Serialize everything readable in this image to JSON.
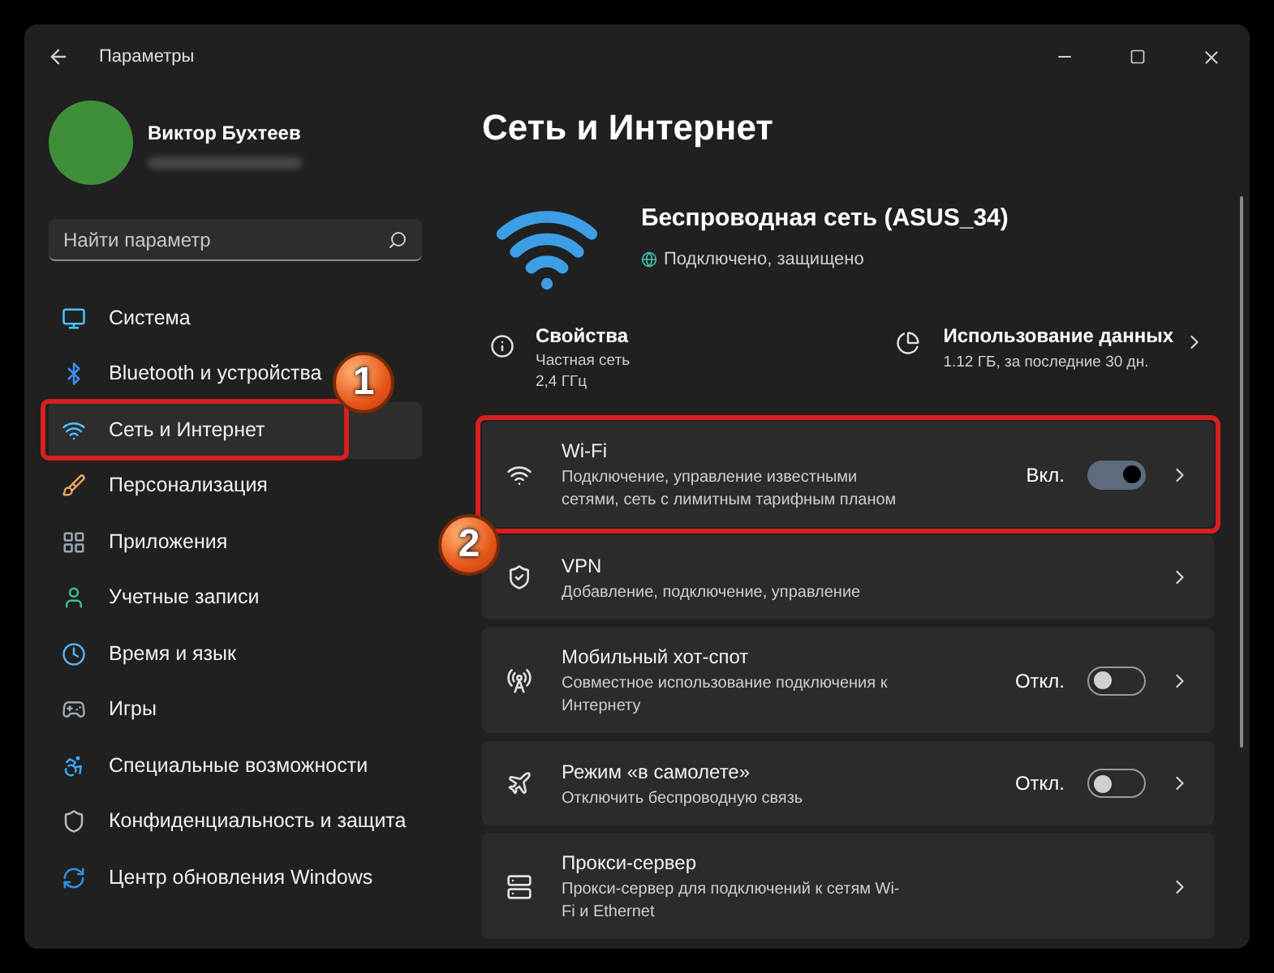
{
  "window": {
    "title": "Параметры"
  },
  "profile": {
    "name": "Виктор Бухтеев"
  },
  "search": {
    "placeholder": "Найти параметр"
  },
  "nav": [
    {
      "label": "Система",
      "selected": false
    },
    {
      "label": "Bluetooth и устройства",
      "selected": false
    },
    {
      "label": "Сеть и Интернет",
      "selected": true,
      "callout": "1"
    },
    {
      "label": "Персонализация",
      "selected": false
    },
    {
      "label": "Приложения",
      "selected": false
    },
    {
      "label": "Учетные записи",
      "selected": false
    },
    {
      "label": "Время и язык",
      "selected": false
    },
    {
      "label": "Игры",
      "selected": false
    },
    {
      "label": "Специальные возможности",
      "selected": false
    },
    {
      "label": "Конфиденциальность и защита",
      "selected": false
    },
    {
      "label": "Центр обновления Windows",
      "selected": false
    }
  ],
  "page": {
    "title": "Сеть и Интернет"
  },
  "network": {
    "name": "Беспроводная сеть (ASUS_34)",
    "status": "Подключено, защищено"
  },
  "properties": {
    "title": "Свойства",
    "lines": [
      "Частная сеть",
      "2,4 ГГц"
    ]
  },
  "data_usage": {
    "title": "Использование данных",
    "detail": "1.12 ГБ, за последние 30 дн."
  },
  "cards": [
    {
      "title": "Wi-Fi",
      "description": "Подключение, управление известными сетями, сеть с лимитным тарифным планом",
      "toggle": {
        "label": "Вкл.",
        "on": true
      },
      "callout": "2"
    },
    {
      "title": "VPN",
      "description": "Добавление, подключение, управление"
    },
    {
      "title": "Мобильный хот-спот",
      "description": "Совместное использование подключения к Интернету",
      "toggle": {
        "label": "Откл.",
        "on": false
      }
    },
    {
      "title": "Режим «в самолете»",
      "description": "Отключить беспроводную связь",
      "toggle": {
        "label": "Откл.",
        "on": false
      }
    },
    {
      "title": "Прокси-сервер",
      "description": "Прокси-сервер для подключений к сетям Wi-Fi и Ethernet"
    }
  ]
}
